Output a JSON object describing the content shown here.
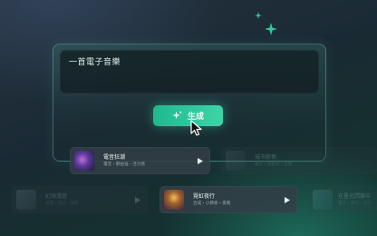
{
  "prompt": {
    "text": "一首電子音樂"
  },
  "generate_button": {
    "label": "生成"
  },
  "tracks": [
    {
      "title": "電音狂潮",
      "subtitle": "電音・節拍強・活力感"
    },
    {
      "title": "城市節奏",
      "subtitle": "電子・律動感・夜晚"
    },
    {
      "title": "幻境漫遊",
      "subtitle": "氛圍・迷幻・放鬆"
    },
    {
      "title": "霓虹夜行",
      "subtitle": "合成・小節奏・夜晚"
    },
    {
      "title": "在星光閃爍中",
      "subtitle": "電子・夢幻・流行"
    }
  ],
  "colors": {
    "accent": "#2ec79c",
    "background": "#1a2a33"
  }
}
